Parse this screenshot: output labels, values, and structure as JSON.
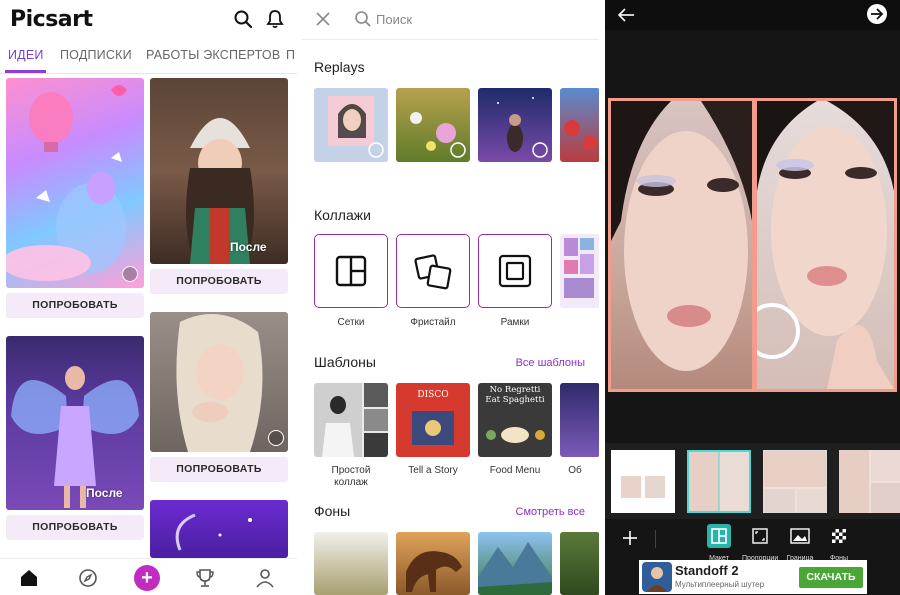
{
  "panel1": {
    "logo": "Picsart",
    "tabs": [
      "ИДЕИ",
      "ПОДПИСКИ",
      "РАБОТЫ ЭКСПЕРТОВ",
      "П"
    ],
    "active_tab": "ИДЕИ",
    "feed": {
      "try_label": "ПОПРОБОВАТЬ",
      "after_label": "После"
    },
    "nav_icons": [
      "home-icon",
      "explore-icon",
      "create-icon",
      "trophy-icon",
      "profile-icon"
    ],
    "accent": "#c02cbf"
  },
  "panel2": {
    "search_placeholder": "Поиск",
    "replays_title": "Replays",
    "collages_title": "Коллажи",
    "collage_items": [
      "Сетки",
      "Фристайл",
      "Рамки"
    ],
    "templates_title": "Шаблоны",
    "templates_link": "Все шаблоны",
    "template_items": [
      "Простой\nколлаж",
      "Tell a Story",
      "Food Menu",
      "Об"
    ],
    "backgrounds_title": "Фоны",
    "backgrounds_link": "Смотреть все",
    "template_text": {
      "disco": "DISCO",
      "food_menu": "No Regretti Eat Spaghetti"
    },
    "accent": "#8a30c8"
  },
  "panel3": {
    "tools": [
      "Макет",
      "Пропорции",
      "Граница",
      "Фоны"
    ],
    "ad": {
      "title": "Standoff 2",
      "subtitle": "Мультиплеерный шутер",
      "button": "СКАЧАТЬ"
    },
    "border_color": "#f39c8b",
    "selection_color": "#4fd6d6"
  }
}
